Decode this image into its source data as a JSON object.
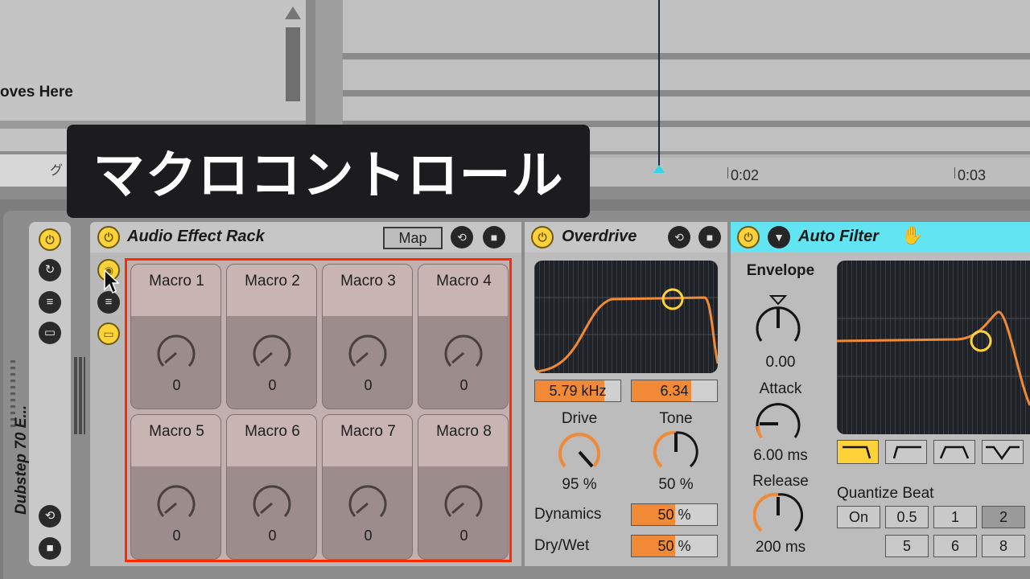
{
  "caption": "マクロコントロール",
  "arrangement": {
    "clip_name": "oves Here",
    "locator_glyph": "グ",
    "ruler_labels": [
      "0:02",
      "0:03"
    ]
  },
  "track": {
    "name": "Dubstep 70 E..."
  },
  "rack": {
    "title": "Audio Effect Rack",
    "map_label": "Map",
    "macros": [
      {
        "label": "Macro 1",
        "value": "0"
      },
      {
        "label": "Macro 2",
        "value": "0"
      },
      {
        "label": "Macro 3",
        "value": "0"
      },
      {
        "label": "Macro 4",
        "value": "0"
      },
      {
        "label": "Macro 5",
        "value": "0"
      },
      {
        "label": "Macro 6",
        "value": "0"
      },
      {
        "label": "Macro 7",
        "value": "0"
      },
      {
        "label": "Macro 8",
        "value": "0"
      }
    ]
  },
  "overdrive": {
    "title": "Overdrive",
    "freq": "5.79 kHz",
    "width": "6.34",
    "drive_label": "Drive",
    "drive_value": "95 %",
    "tone_label": "Tone",
    "tone_value": "50 %",
    "dynamics_label": "Dynamics",
    "dynamics_value": "50",
    "drywet_label": "Dry/Wet",
    "drywet_value": "50",
    "percent": "%"
  },
  "autofilter": {
    "title": "Auto Filter",
    "envelope_label": "Envelope",
    "envelope_value": "0.00",
    "attack_label": "Attack",
    "attack_value": "6.00 ms",
    "release_label": "Release",
    "release_value": "200 ms",
    "quantize_label": "Quantize Beat",
    "quantize_on": "On",
    "quantize_row1": [
      "0.5",
      "1",
      "2"
    ],
    "quantize_row2": [
      "5",
      "6",
      "8"
    ]
  },
  "colors": {
    "accent_orange": "#f08a36",
    "power_yellow": "#ffd23a",
    "selection_red": "#ff2a00",
    "autofilter_cyan": "#63e4f2"
  },
  "icons": [
    "power-icon",
    "hot-swap-icon",
    "save-icon",
    "list-icon",
    "collapse-icon",
    "hand-icon",
    "arrow-cursor-icon"
  ]
}
